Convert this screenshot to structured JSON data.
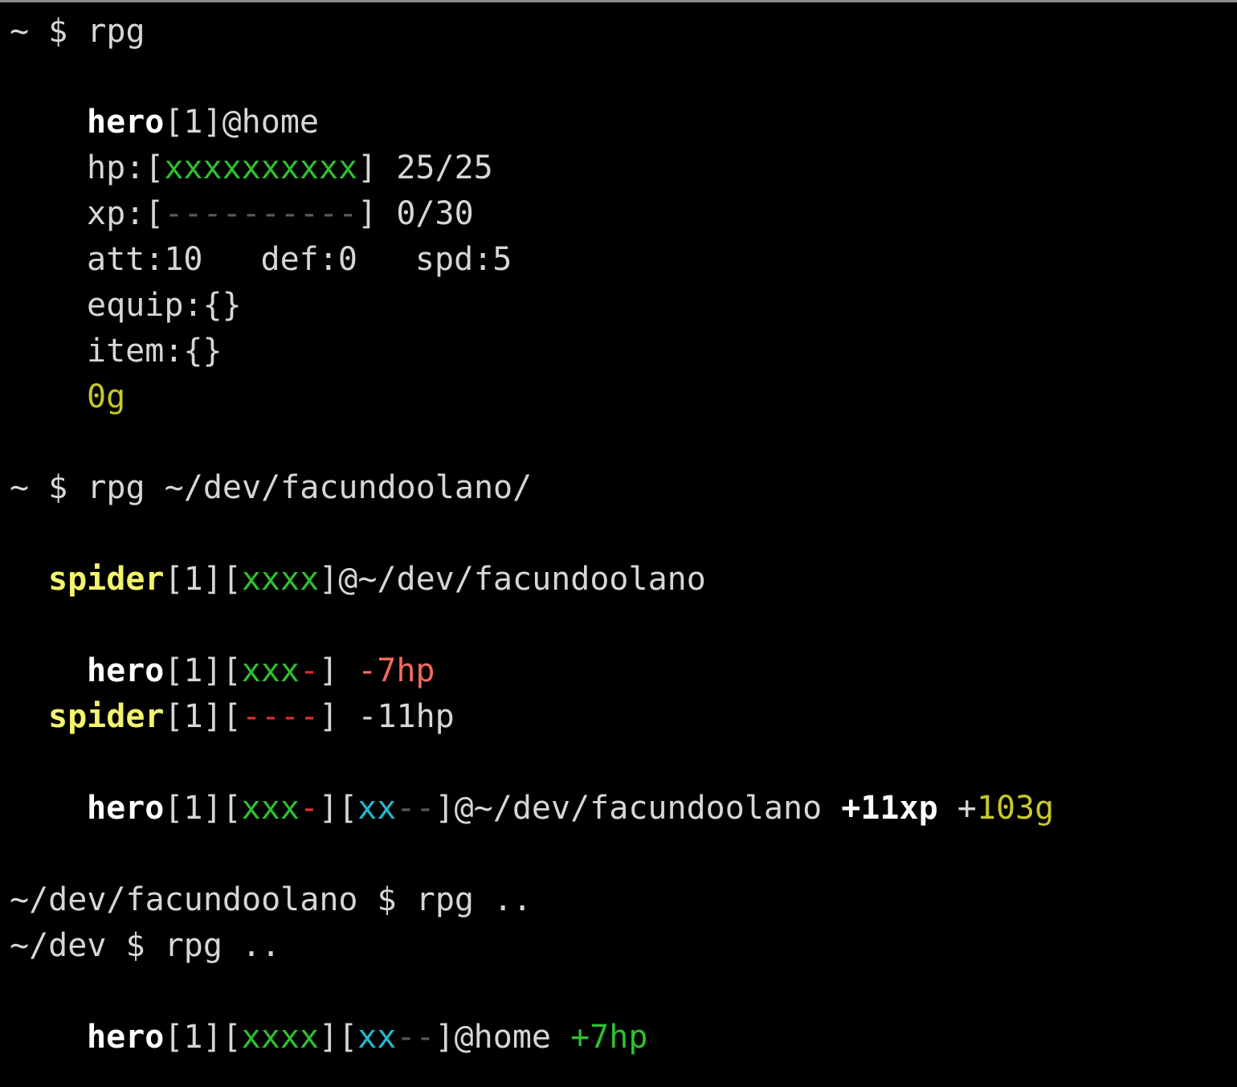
{
  "terminal": {
    "cmd1": {
      "prompt": "~ $ ",
      "command": "rpg"
    },
    "status": {
      "hero_name": "hero",
      "hero_level": "[1]",
      "hero_location": "@home",
      "hp_label": "hp:[",
      "hp_bar": "xxxxxxxxxx",
      "hp_close": "]",
      "hp_value": " 25/25",
      "xp_label": "xp:[",
      "xp_bar": "----------",
      "xp_close": "]",
      "xp_value": " 0/30",
      "att": "att:10",
      "def": "def:0",
      "spd": "spd:5",
      "equip": "equip:{}",
      "item": "item:{}",
      "gold": "0g"
    },
    "cmd2": {
      "prompt": "~ $ ",
      "command": "rpg ~/dev/facundoolano/"
    },
    "encounter": {
      "enemy_name": "spider",
      "enemy_level": "[1][",
      "enemy_bar": "xxxx",
      "enemy_close": "]",
      "enemy_location": "@~/dev/facundoolano"
    },
    "battle_hero": {
      "name": "hero",
      "level": "[1][",
      "hp_full": "xxx",
      "hp_lost": "-",
      "close": "] ",
      "damage": "-7hp"
    },
    "battle_spider": {
      "name": "spider",
      "level": "[1][",
      "hp_lost": "----",
      "close": "] ",
      "damage": "-11hp"
    },
    "result": {
      "name": "hero",
      "level": "[1][",
      "hp_full": "xxx",
      "hp_lost": "-",
      "mid": "][",
      "xp_full": "xx",
      "xp_empty": "--",
      "location": "]@~/dev/facundoolano ",
      "xp_gain": "+11xp",
      "space": " ",
      "gold_plus": "+",
      "gold_gain": "103g"
    },
    "cmd3": {
      "prompt": "~/dev/facundoolano $ ",
      "command": "rpg .."
    },
    "cmd4": {
      "prompt": "~/dev $ ",
      "command": "rpg .."
    },
    "heal": {
      "name": "hero",
      "level": "[1][",
      "hp_full": "xxxx",
      "mid": "][",
      "xp_full": "xx",
      "xp_empty": "--",
      "location": "]@home ",
      "hp_gain": "+7hp"
    }
  }
}
